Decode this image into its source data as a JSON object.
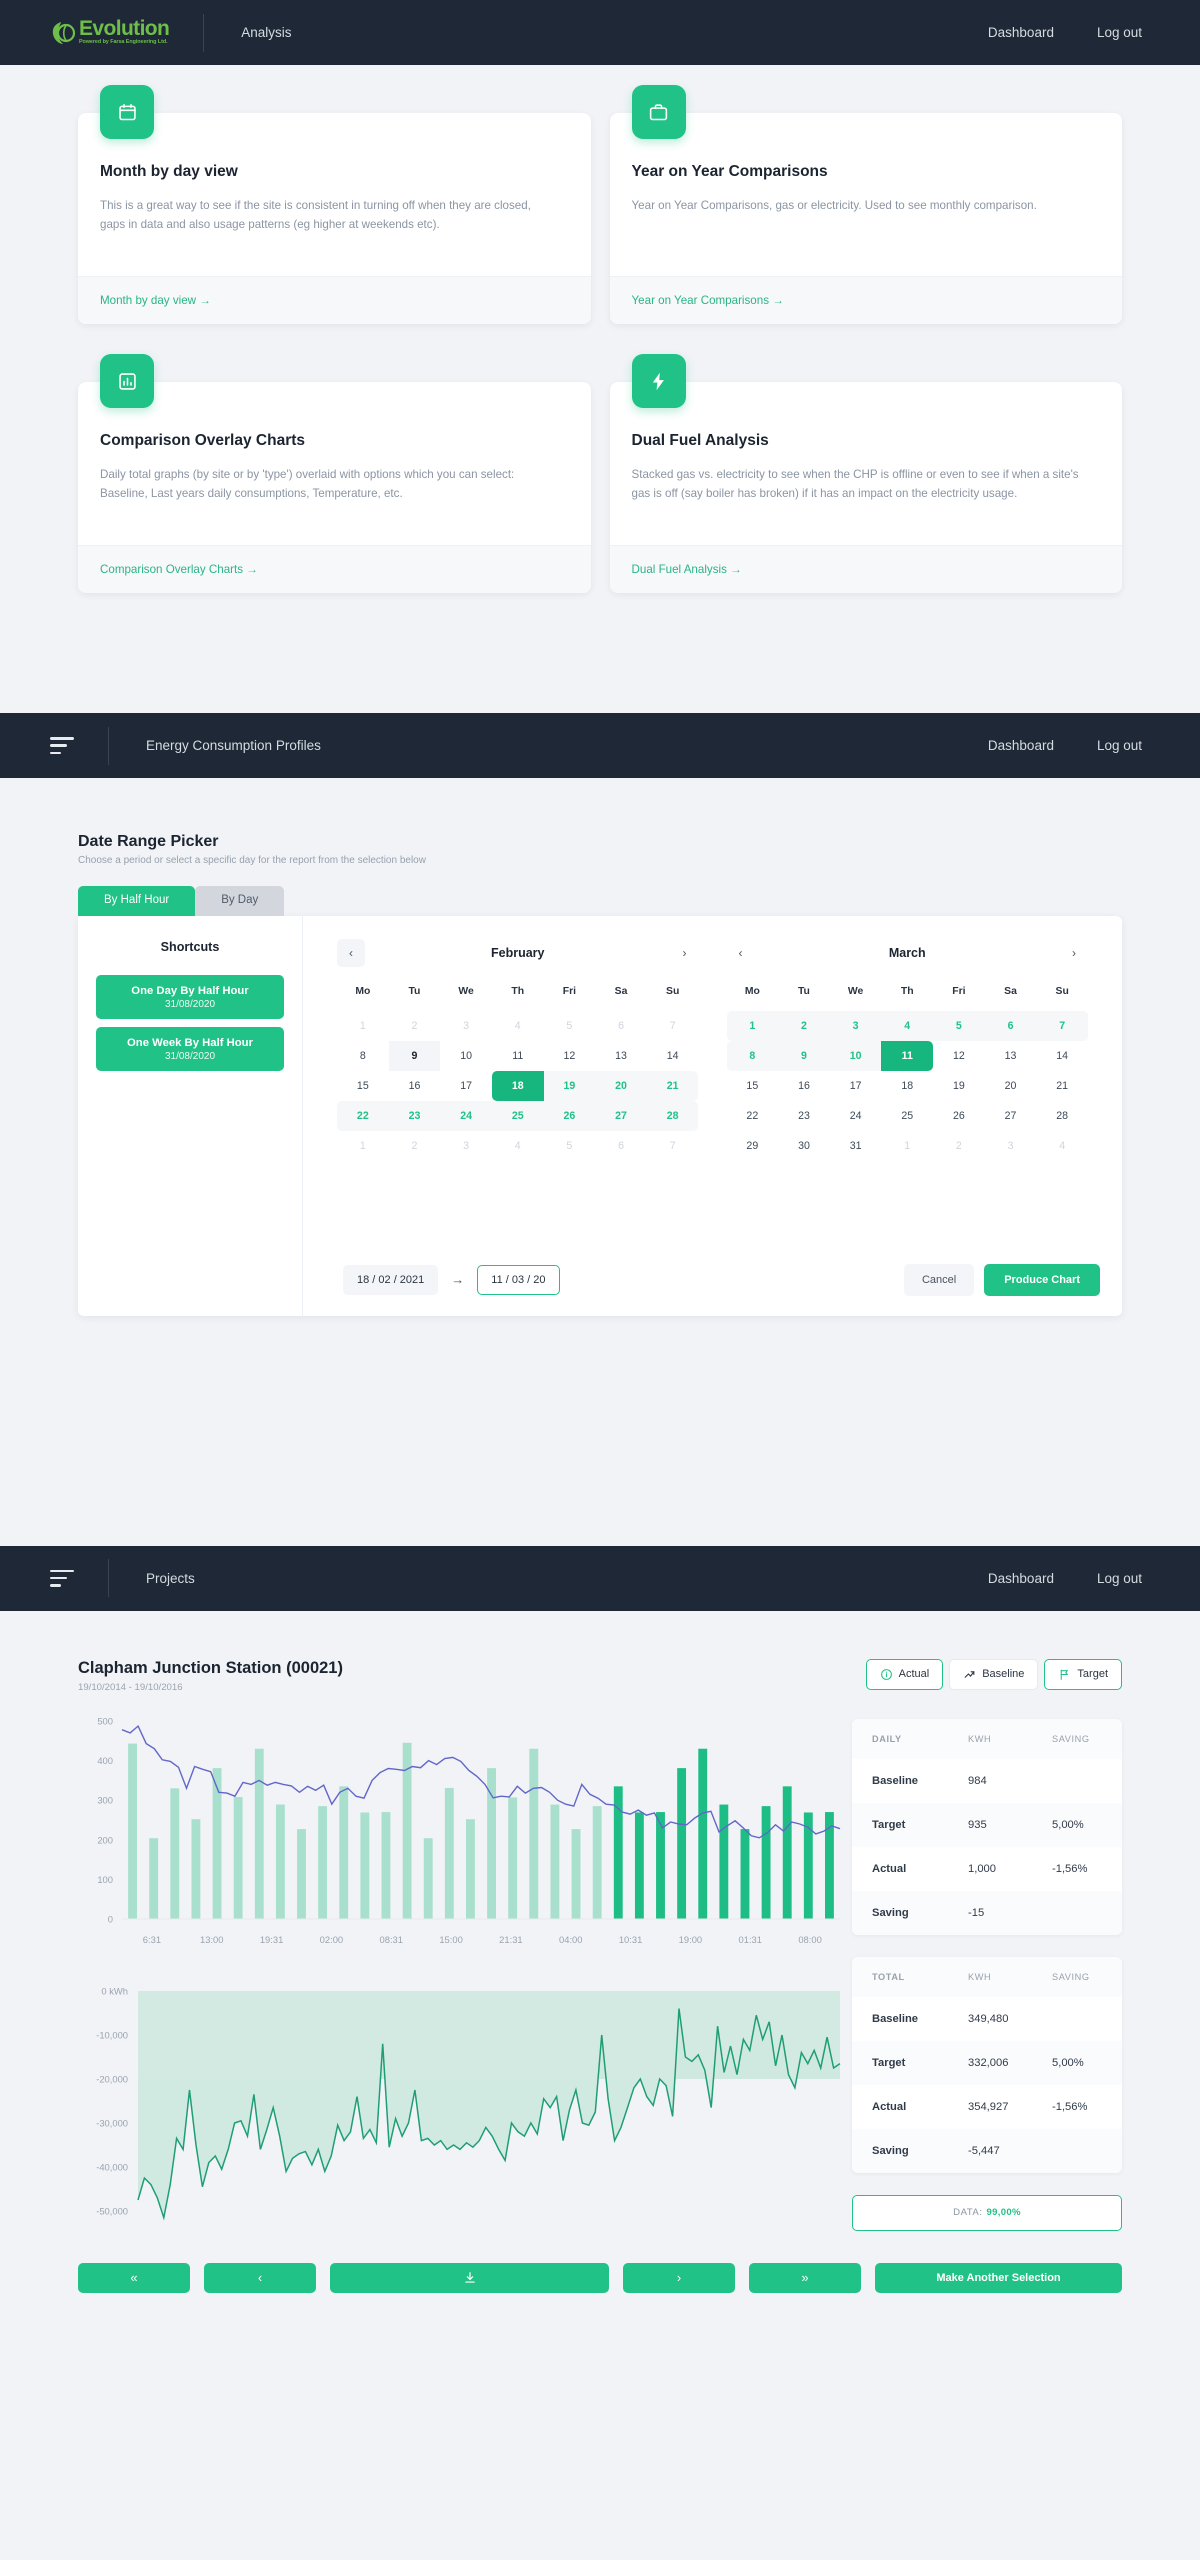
{
  "brand": {
    "name": "Evolution",
    "tagline": "Powered by Farsa Engineering Ltd.",
    "accent": "#6ebe4a",
    "green": "#21c287",
    "navbar_bg": "#1e2836"
  },
  "navbars": [
    {
      "title": "Analysis",
      "links": [
        "Dashboard",
        "Log out"
      ]
    },
    {
      "title": "Energy Consumption Profiles",
      "links": [
        "Dashboard",
        "Log out"
      ]
    },
    {
      "title": "Projects",
      "links": [
        "Dashboard",
        "Log out"
      ]
    }
  ],
  "feature_cards": [
    {
      "icon": "calendar-icon",
      "title": "Month by day view",
      "description": "This is a great way to see if the site is consistent in turning off when they are closed, gaps in data and also usage patterns (eg higher at weekends etc).",
      "link": "Month by day view →"
    },
    {
      "icon": "briefcase-icon",
      "title": "Year on Year Comparisons",
      "description": "Year on Year Comparisons, gas or electricity. Used to see monthly comparison.",
      "link": "Year on Year Comparisons →"
    },
    {
      "icon": "bar-chart-icon",
      "title": "Comparison Overlay Charts",
      "description": "Daily total graphs (by site or by 'type') overlaid with options which you can select: Baseline, Last years daily consumptions, Temperature, etc.",
      "link": "Comparison Overlay Charts →"
    },
    {
      "icon": "lightning-icon",
      "title": "Dual Fuel Analysis",
      "description": "Stacked gas vs. electricity to see when the CHP is offline or even to see if when a site's gas is off (say boiler has broken) if it has an impact on the electricity usage.",
      "link": "Dual Fuel Analysis →"
    }
  ],
  "date_picker": {
    "title": "Date Range Picker",
    "subtitle": "Choose a period or select a specific day for the report from the selection below",
    "tabs": [
      {
        "label": "By Half Hour",
        "active": true
      },
      {
        "label": "By Day",
        "active": false
      }
    ],
    "shortcuts_title": "Shortcuts",
    "shortcuts": [
      {
        "label": "One Day By Half Hour",
        "date": "31/08/2020"
      },
      {
        "label": "One Week By Half Hour",
        "date": "31/08/2020"
      }
    ],
    "day_names": [
      "Mo",
      "Tu",
      "We",
      "Th",
      "Fri",
      "Sa",
      "Su"
    ],
    "prev_icon": "chevron-left-icon",
    "next_icon": "chevron-right-icon",
    "calendars": [
      {
        "month": "February",
        "weeks": [
          [
            {
              "d": "1",
              "s": "muted"
            },
            {
              "d": "2",
              "s": "muted"
            },
            {
              "d": "3",
              "s": "muted"
            },
            {
              "d": "4",
              "s": "muted"
            },
            {
              "d": "5",
              "s": "muted"
            },
            {
              "d": "6",
              "s": "muted"
            },
            {
              "d": "7",
              "s": "muted"
            }
          ],
          [
            {
              "d": "8",
              "s": ""
            },
            {
              "d": "9",
              "s": "hover"
            },
            {
              "d": "10",
              "s": ""
            },
            {
              "d": "11",
              "s": ""
            },
            {
              "d": "12",
              "s": ""
            },
            {
              "d": "13",
              "s": ""
            },
            {
              "d": "14",
              "s": ""
            }
          ],
          [
            {
              "d": "15",
              "s": ""
            },
            {
              "d": "16",
              "s": ""
            },
            {
              "d": "17",
              "s": ""
            },
            {
              "d": "18",
              "s": "sel sel-start"
            },
            {
              "d": "19",
              "s": "inrange"
            },
            {
              "d": "20",
              "s": "inrange"
            },
            {
              "d": "21",
              "s": "inrange range-end"
            }
          ],
          [
            {
              "d": "22",
              "s": "inrange range-start"
            },
            {
              "d": "23",
              "s": "inrange"
            },
            {
              "d": "24",
              "s": "inrange"
            },
            {
              "d": "25",
              "s": "inrange"
            },
            {
              "d": "26",
              "s": "inrange"
            },
            {
              "d": "27",
              "s": "inrange"
            },
            {
              "d": "28",
              "s": "inrange range-end"
            }
          ],
          [
            {
              "d": "1",
              "s": "muted"
            },
            {
              "d": "2",
              "s": "muted"
            },
            {
              "d": "3",
              "s": "muted"
            },
            {
              "d": "4",
              "s": "muted"
            },
            {
              "d": "5",
              "s": "muted"
            },
            {
              "d": "6",
              "s": "muted"
            },
            {
              "d": "7",
              "s": "muted"
            }
          ]
        ]
      },
      {
        "month": "March",
        "weeks": [
          [
            {
              "d": "1",
              "s": "inrange range-start"
            },
            {
              "d": "2",
              "s": "inrange"
            },
            {
              "d": "3",
              "s": "inrange"
            },
            {
              "d": "4",
              "s": "inrange"
            },
            {
              "d": "5",
              "s": "inrange"
            },
            {
              "d": "6",
              "s": "inrange"
            },
            {
              "d": "7",
              "s": "inrange range-end"
            }
          ],
          [
            {
              "d": "8",
              "s": "inrange range-start"
            },
            {
              "d": "9",
              "s": "inrange"
            },
            {
              "d": "10",
              "s": "inrange"
            },
            {
              "d": "11",
              "s": "sel sel-end"
            },
            {
              "d": "12",
              "s": ""
            },
            {
              "d": "13",
              "s": ""
            },
            {
              "d": "14",
              "s": ""
            }
          ],
          [
            {
              "d": "15",
              "s": ""
            },
            {
              "d": "16",
              "s": ""
            },
            {
              "d": "17",
              "s": ""
            },
            {
              "d": "18",
              "s": ""
            },
            {
              "d": "19",
              "s": ""
            },
            {
              "d": "20",
              "s": ""
            },
            {
              "d": "21",
              "s": ""
            }
          ],
          [
            {
              "d": "22",
              "s": ""
            },
            {
              "d": "23",
              "s": ""
            },
            {
              "d": "24",
              "s": ""
            },
            {
              "d": "25",
              "s": ""
            },
            {
              "d": "26",
              "s": ""
            },
            {
              "d": "27",
              "s": ""
            },
            {
              "d": "28",
              "s": ""
            }
          ],
          [
            {
              "d": "29",
              "s": ""
            },
            {
              "d": "30",
              "s": ""
            },
            {
              "d": "31",
              "s": ""
            },
            {
              "d": "1",
              "s": "muted"
            },
            {
              "d": "2",
              "s": "muted"
            },
            {
              "d": "3",
              "s": "muted"
            },
            {
              "d": "4",
              "s": "muted"
            }
          ]
        ]
      }
    ],
    "start_date": "18 / 02 / 2021",
    "end_date": "11 / 03 / 20",
    "range_arrow": "→",
    "cancel_label": "Cancel",
    "produce_label": "Produce Chart"
  },
  "report": {
    "title": "Clapham Junction Station (00021)",
    "date_range": "19/10/2014 - 19/10/2016",
    "toggles": [
      {
        "label": "Actual",
        "icon": "info-circle-icon",
        "on": true
      },
      {
        "label": "Baseline",
        "icon": "trend-up-icon",
        "on": false
      },
      {
        "label": "Target",
        "icon": "flag-icon",
        "on": true
      }
    ],
    "tables": [
      {
        "headers": [
          "DAILY",
          "KWH",
          "SAVING"
        ],
        "rows": [
          [
            "Baseline",
            "984",
            ""
          ],
          [
            "Target",
            "935",
            "5,00%"
          ],
          [
            "Actual",
            "1,000",
            "-1,56%"
          ],
          [
            "Saving",
            "-15",
            ""
          ]
        ]
      },
      {
        "headers": [
          "TOTAL",
          "KWH",
          "SAVING"
        ],
        "rows": [
          [
            "Baseline",
            "349,480",
            ""
          ],
          [
            "Target",
            "332,006",
            "5,00%"
          ],
          [
            "Actual",
            "354,927",
            "-1,56%"
          ],
          [
            "Saving",
            "-5,447",
            ""
          ]
        ]
      }
    ],
    "data_pill_label": "DATA:",
    "data_pill_value": "99,00%",
    "buttons": [
      {
        "label": "«",
        "name": "first-page-button"
      },
      {
        "label": "‹",
        "name": "prev-page-button"
      },
      {
        "label": "⤓",
        "name": "download-button"
      },
      {
        "label": "›",
        "name": "next-page-button"
      },
      {
        "label": "»",
        "name": "last-page-button"
      },
      {
        "label": "Make Another Selection",
        "name": "make-another-selection-button"
      }
    ]
  },
  "chart_data": [
    {
      "type": "bar",
      "title": "Half hourly consumption",
      "xlabel": "",
      "ylabel": "kWh",
      "ylim": [
        0,
        500
      ],
      "yticks": [
        0,
        100,
        200,
        300,
        400,
        500
      ],
      "xtick_labels": [
        "6:31",
        "13:00",
        "19:31",
        "02:00",
        "08:31",
        "15:00",
        "21:31",
        "04:00",
        "10:31",
        "19:00",
        "01:31",
        "08:00"
      ],
      "grid": false,
      "legend": "none",
      "series": [
        {
          "name": "Consumption bars",
          "type": "bar",
          "colors": {
            "past": "#a9e0cd",
            "current": "#1dbd85"
          },
          "split_index": 23,
          "values": [
            443,
            204,
            330,
            252,
            381,
            308,
            430,
            289,
            227,
            285,
            335,
            269,
            270,
            445,
            204,
            331,
            252,
            381,
            307,
            430,
            289,
            227,
            285,
            335,
            269,
            270,
            381,
            430,
            289,
            227,
            285,
            335,
            269,
            270
          ]
        },
        {
          "name": "Baseline line",
          "type": "line",
          "color": "#6366c9",
          "values": [
            478,
            470,
            487,
            443,
            430,
            402,
            398,
            383,
            330,
            385,
            378,
            372,
            320,
            318,
            310,
            345,
            340,
            350,
            338,
            345,
            340,
            336,
            320,
            335,
            325,
            338,
            290,
            320,
            330,
            310,
            305,
            350,
            370,
            380,
            378,
            375,
            385,
            382,
            400,
            390,
            405,
            408,
            398,
            375,
            360,
            340,
            306,
            310,
            308,
            335,
            318,
            330,
            332,
            320,
            300,
            290,
            285,
            340,
            315,
            305,
            290,
            288,
            270,
            265,
            275,
            262,
            268,
            230,
            245,
            240,
            238,
            255,
            268,
            272,
            220,
            235,
            248,
            230,
            210,
            205,
            218,
            238,
            222,
            245,
            240,
            232,
            215,
            222,
            235,
            228
          ]
        }
      ]
    },
    {
      "type": "area",
      "title": "Cumulative saving",
      "xlabel": "",
      "ylabel": "kWh",
      "ylim": [
        -50000,
        0
      ],
      "yticks": [
        0,
        -10000,
        -20000,
        -30000,
        -40000,
        -50000
      ],
      "ytick_labels": [
        "0 kWh",
        "-10,000",
        "-20,000",
        "-30,000",
        "-40,000",
        "-50,000"
      ],
      "grid": true,
      "legend": "none",
      "series": [
        {
          "name": "Cumulative saving",
          "color": "#1f9e75",
          "fill": "#cfe9df",
          "values": [
            -47500,
            -42500,
            -44000,
            -47000,
            -51500,
            -44000,
            -33500,
            -36000,
            -22500,
            -35000,
            -44500,
            -39000,
            -37500,
            -40500,
            -36000,
            -30000,
            -29500,
            -33000,
            -23500,
            -36000,
            -31500,
            -26500,
            -33000,
            -41000,
            -38000,
            -37000,
            -36500,
            -39500,
            -36000,
            -41000,
            -37500,
            -30500,
            -34000,
            -32000,
            -24000,
            -33500,
            -31500,
            -34500,
            -12000,
            -35500,
            -29000,
            -33000,
            -30000,
            -22500,
            -34000,
            -33500,
            -35000,
            -34000,
            -36000,
            -35000,
            -36000,
            -34500,
            -35500,
            -34000,
            -31000,
            -33000,
            -36000,
            -38500,
            -30000,
            -32000,
            -33000,
            -30000,
            -32500,
            -24500,
            -26500,
            -24000,
            -34000,
            -27000,
            -22500,
            -30000,
            -30500,
            -27500,
            -10000,
            -24500,
            -34000,
            -31000,
            -26500,
            -22000,
            -20000,
            -24000,
            -26000,
            -20000,
            -21500,
            -28500,
            -4000,
            -15000,
            -16000,
            -14500,
            -18000,
            -26500,
            -8000,
            -18500,
            -12500,
            -19000,
            -11000,
            -13500,
            -5500,
            -11000,
            -7000,
            -17000,
            -10000,
            -19000,
            -22000,
            -14000,
            -16500,
            -13500,
            -17500,
            -10500,
            -17500,
            -16500
          ]
        }
      ]
    }
  ]
}
